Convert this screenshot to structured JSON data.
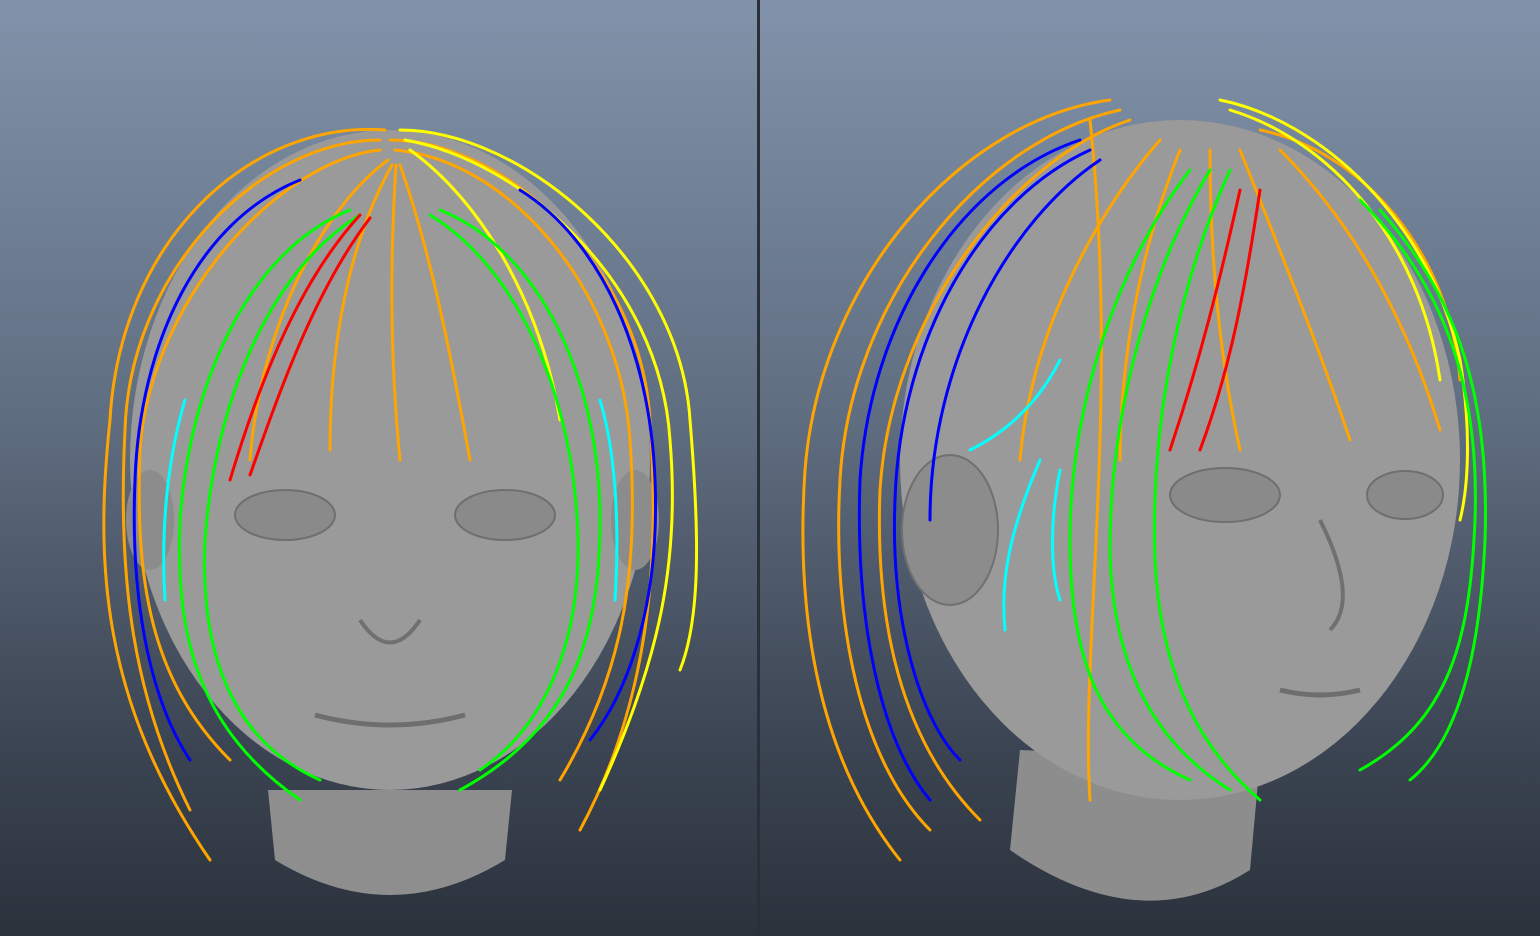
{
  "viewports": [
    {
      "name": "front",
      "view": "front"
    },
    {
      "name": "three-quarter",
      "view": "three-quarter"
    }
  ],
  "colors": {
    "background_top": "#8193aa",
    "background_bottom": "#2b323c",
    "skin": "#9b9b9b",
    "hair_guides": [
      "#ffa500",
      "#ffff00",
      "#0000ff",
      "#00ff00",
      "#ff0000",
      "#00ffff"
    ]
  },
  "icons": [
    "head-mesh-icon",
    "hair-guide-curves-icon"
  ]
}
